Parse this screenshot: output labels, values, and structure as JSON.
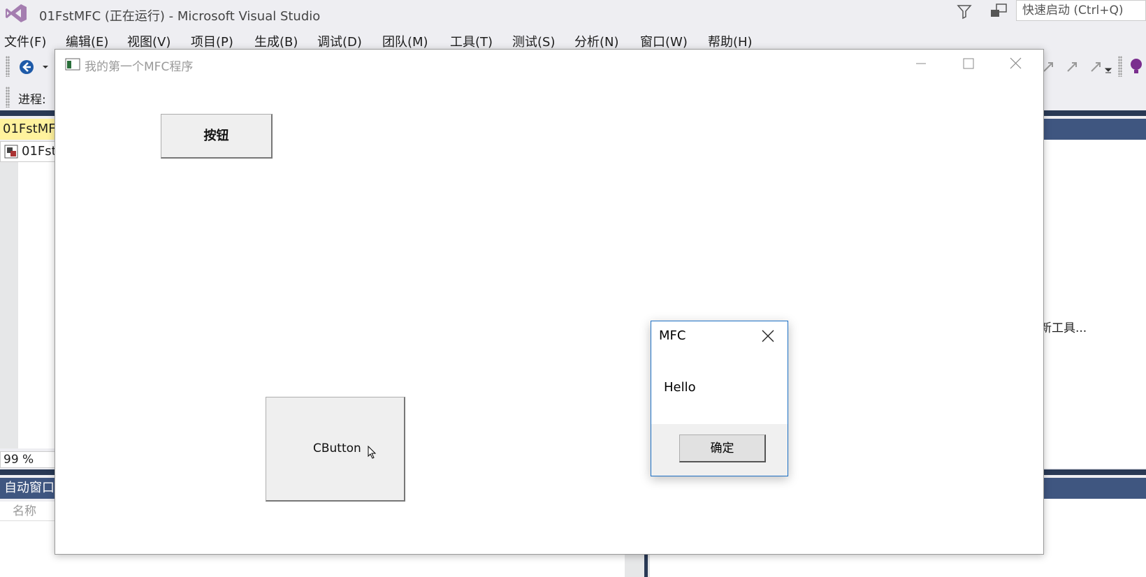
{
  "vs": {
    "window_title": "01FstMFC (正在运行) - Microsoft Visual Studio",
    "quick_launch_placeholder": "快速启动 (Ctrl+Q)",
    "menu": [
      "文件(F)",
      "编辑(E)",
      "视图(V)",
      "项目(P)",
      "生成(B)",
      "调试(D)",
      "团队(M)",
      "工具(T)",
      "测试(S)",
      "分析(N)",
      "窗口(W)",
      "帮助(H)"
    ],
    "process_label": "进程:",
    "doc_tab": "01FstMFC",
    "editor_nav": "01FstMFC",
    "zoom": "99 %",
    "autos_tab": "自动窗口",
    "autos_column_name": "名称",
    "right_panel_text": "新工具..."
  },
  "mfc_window": {
    "title": "我的第一个MFC程序",
    "button1_label": "按钮",
    "button2_label": "CButton"
  },
  "msgbox": {
    "title": "MFC",
    "message": "Hello",
    "ok_label": "确定"
  },
  "colors": {
    "vs_chrome": "#eeeef2",
    "vs_panel_header": "#3f5680",
    "doc_tab_active": "#fff29d",
    "msgbox_border": "#1c6fc4"
  }
}
